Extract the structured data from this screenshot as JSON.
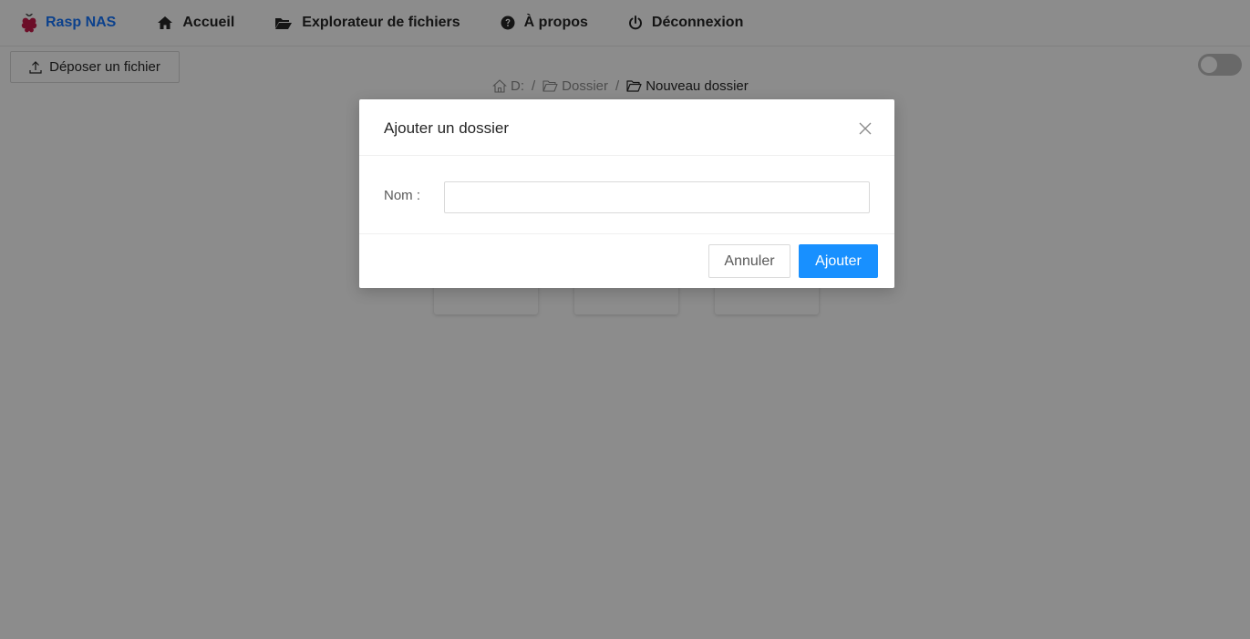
{
  "navbar": {
    "brand": "Rasp NAS",
    "items": [
      {
        "label": "Accueil",
        "icon": "home-icon"
      },
      {
        "label": "Explorateur de fichiers",
        "icon": "folder-open-icon"
      },
      {
        "label": "À propos",
        "icon": "question-circle-icon"
      },
      {
        "label": "Déconnexion",
        "icon": "power-icon"
      }
    ],
    "brand_icon": "raspberry-icon",
    "brand_color": "#1677ff"
  },
  "toolbar": {
    "upload_label": "Déposer un fichier",
    "upload_icon": "upload-icon",
    "theme_toggle_on": false
  },
  "breadcrumb": {
    "items": [
      {
        "label": "D:",
        "icon": "home-icon"
      },
      {
        "label": "Dossier",
        "icon": "folder-icon"
      },
      {
        "label": "Nouveau dossier",
        "icon": "folder-icon"
      }
    ],
    "separator": "/"
  },
  "modal": {
    "title": "Ajouter un dossier",
    "name_label": "Nom :",
    "name_value": "",
    "name_placeholder": "",
    "cancel_label": "Annuler",
    "ok_label": "Ajouter",
    "ok_color": "#1890ff"
  }
}
